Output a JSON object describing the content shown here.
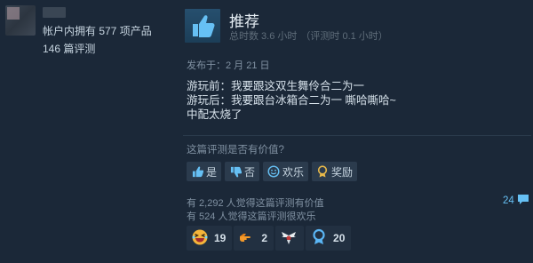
{
  "reviewer": {
    "owned_products": "帐户内拥有 577 项产品",
    "review_count": "146 篇评测"
  },
  "review": {
    "verdict": "推荐",
    "hours_total": "总时数 3.6 小时",
    "hours_at_review": "（评测时 0.1 小时）",
    "posted": "发布于：2 月 21 日",
    "body_lines": [
      "游玩前：我要跟这双生舞伶合二为一",
      "游玩后：我要跟台冰箱合二为一 嘶哈嘶哈~",
      "中配太烧了"
    ]
  },
  "helpful": {
    "question": "这篇评测是否有价值?",
    "yes_label": "是",
    "no_label": "否",
    "funny_label": "欢乐",
    "award_label": "奖励"
  },
  "votes": {
    "helpful_text": "有 2,292 人觉得这篇评测有价值",
    "funny_text": "有 524 人觉得这篇评测很欢乐"
  },
  "comments": {
    "count": "24"
  },
  "awards": [
    {
      "icon": "laughing-face-icon",
      "count": "19"
    },
    {
      "icon": "pointing-hand-icon",
      "count": "2"
    },
    {
      "icon": "winged-emblem-icon",
      "count": ""
    },
    {
      "icon": "medal-ribbon-icon",
      "count": "20"
    }
  ],
  "colors": {
    "background": "#1b2838",
    "link": "#66c0f4",
    "thumb_box": "#264f6e"
  }
}
